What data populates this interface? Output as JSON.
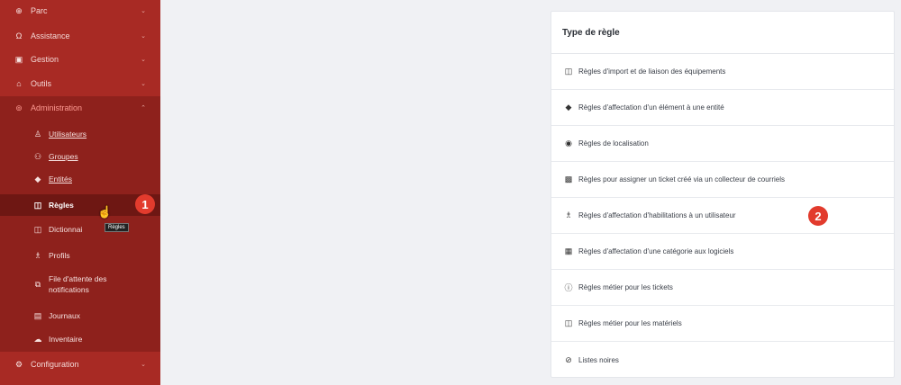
{
  "sidebar": {
    "items": [
      {
        "label": "Parc",
        "icon": "box-icon"
      },
      {
        "label": "Assistance",
        "icon": "headset-icon"
      },
      {
        "label": "Gestion",
        "icon": "wallet-icon"
      },
      {
        "label": "Outils",
        "icon": "briefcase-icon"
      },
      {
        "label": "Administration",
        "icon": "shield-icon"
      },
      {
        "label": "Configuration",
        "icon": "gear-icon"
      }
    ],
    "sub_items": [
      {
        "label": "Utilisateurs",
        "icon": "user-icon"
      },
      {
        "label": "Groupes",
        "icon": "users-icon"
      },
      {
        "label": "Entités",
        "icon": "stack-icon"
      },
      {
        "label": "Règles",
        "icon": "book-icon"
      },
      {
        "label": "Dictionnai",
        "icon": "book-icon"
      },
      {
        "label": "Profils",
        "icon": "user-check-icon"
      },
      {
        "label": "File d'attente des\nnotifications",
        "icon": "bell-icon"
      },
      {
        "label": "Journaux",
        "icon": "log-icon"
      },
      {
        "label": "Inventaire",
        "icon": "cloud-icon"
      }
    ],
    "tooltip": "Règles"
  },
  "badges": {
    "one": "1",
    "two": "2"
  },
  "panel": {
    "title": "Type de règle",
    "rules": [
      {
        "label": "Règles d'import et de liaison des équipements",
        "icon": "book-icon"
      },
      {
        "label": "Règles d'affectation d'un élément à une entité",
        "icon": "stack-icon"
      },
      {
        "label": "Règles de localisation",
        "icon": "location-icon"
      },
      {
        "label": "Règles pour assigner un ticket créé via un collecteur de courriels",
        "icon": "mailbox-icon"
      },
      {
        "label": "Règles d'affectation d'habilitations à un utilisateur",
        "icon": "user-check-icon"
      },
      {
        "label": "Règles d'affectation d'une catégorie aux logiciels",
        "icon": "category-icon"
      },
      {
        "label": "Règles métier pour les tickets",
        "icon": "alert-circle-icon"
      },
      {
        "label": "Règles métier pour les matériels",
        "icon": "book-icon"
      },
      {
        "label": "Listes noires",
        "icon": "ban-icon"
      }
    ]
  }
}
